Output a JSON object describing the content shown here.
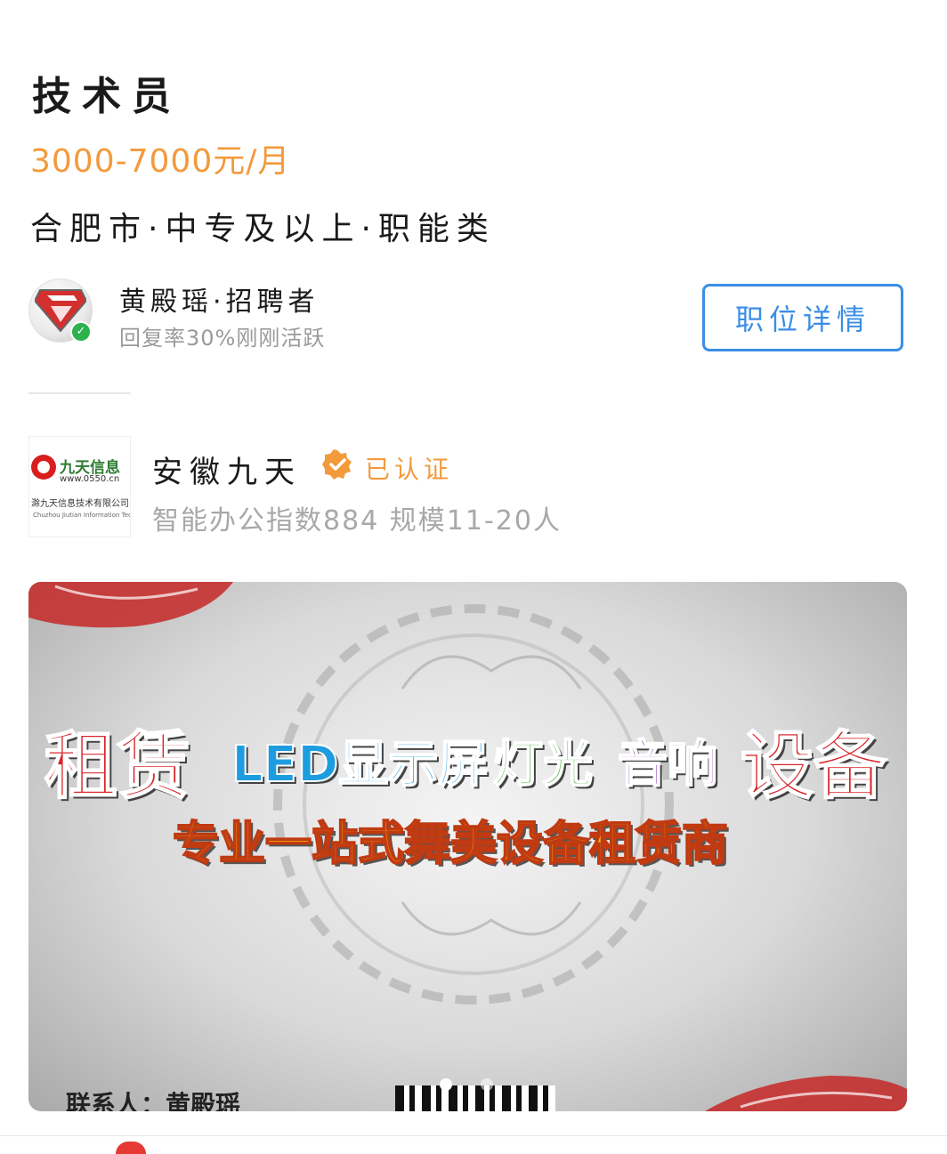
{
  "job": {
    "title": "技术员",
    "salary": "3000-7000元/月",
    "meta": "合肥市·中专及以上·职能类"
  },
  "recruiter": {
    "name": "黄殿瑶·招聘者",
    "status": "回复率30%刚刚活跃",
    "detail_button": "职位详情"
  },
  "company": {
    "logo_text": "九天信息",
    "logo_url": "www.0550.cn",
    "logo_sub": "滁九天信息技术有限公司",
    "logo_sub_en": "Chuzhou Jiutian Information Technology Co.",
    "name": "安徽九天",
    "verified_label": "已认证",
    "stats": "智能办公指数884 规模11-20人"
  },
  "banner": {
    "word1": "租赁",
    "word2": "LED显示屏",
    "word3": "灯光",
    "word4": "音响",
    "word5": "设备",
    "tagline": "专业一站式舞美设备租赁商",
    "contact": "联系人：黄殿瑶",
    "page_index": 1,
    "page_count": 2
  },
  "colors": {
    "accent_orange": "#f39a3b",
    "accent_blue": "#3a8ee6",
    "online_green": "#2bb24c"
  },
  "icons": {
    "online": "check-badge-icon",
    "verified": "verified-badge-icon"
  }
}
